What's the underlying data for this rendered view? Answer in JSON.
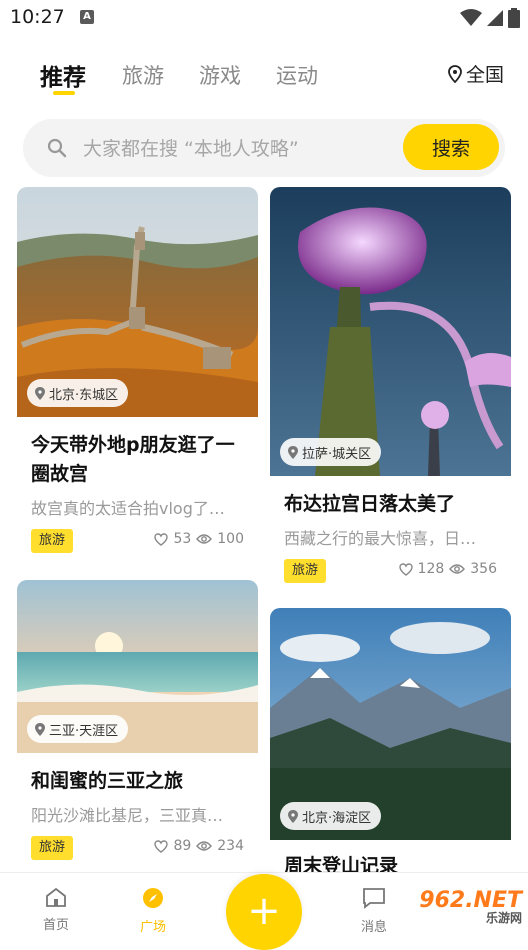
{
  "status": {
    "time": "10:27",
    "notif": "A"
  },
  "tabs": [
    {
      "label": "推荐",
      "active": true
    },
    {
      "label": "旅游",
      "active": false
    },
    {
      "label": "游戏",
      "active": false
    },
    {
      "label": "运动",
      "active": false
    }
  ],
  "location": {
    "label": "全国",
    "icon": "map-pin-icon"
  },
  "search": {
    "placeholder": "大家都在搜 “本地人攻略”",
    "button": "搜索"
  },
  "cards": [
    {
      "location": "北京·东城区",
      "title": "今天带外地p朋友逛了一圈故宫",
      "desc": "故宫真的太适合拍vlog了…",
      "tag": "旅游",
      "likes": "53",
      "views": "100"
    },
    {
      "location": "拉萨·城关区",
      "title": "布达拉宫日落太美了",
      "desc": "西藏之行的最大惊喜，日…",
      "tag": "旅游",
      "likes": "128",
      "views": "356"
    },
    {
      "location": "三亚·天涯区",
      "title": "和闺蜜的三亚之旅",
      "desc": "阳光沙滩比基尼，三亚真…",
      "tag": "旅游",
      "likes": "89",
      "views": "234"
    },
    {
      "location": "北京·海淀区",
      "title": "周末登山记录"
    }
  ],
  "nav": [
    {
      "label": "首页",
      "icon": "home-icon"
    },
    {
      "label": "广场",
      "icon": "compass-icon",
      "active": true
    },
    {
      "label": "消息",
      "icon": "message-icon"
    }
  ],
  "fab": {
    "label": "+"
  },
  "watermark": {
    "brand": "962.NET",
    "sub": "乐游网"
  },
  "colors": {
    "accent": "#ffd400",
    "badge": "#ffde2e"
  }
}
